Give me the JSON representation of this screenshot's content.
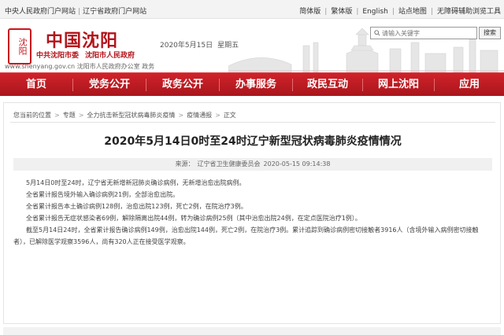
{
  "topbar": {
    "links_left": [
      "中央人民政府门户网站",
      "辽宁省政府门户网站"
    ],
    "links_right": [
      "简体版",
      "繁体版",
      "English",
      "站点地图",
      "无障碍辅助浏览工具"
    ]
  },
  "header": {
    "site_name": "中国沈阳",
    "org_party": "中共沈阳市委",
    "org_gov": "沈阳市人民政府",
    "domain_text": "www.shenyang.gov.cn 沈阳市人民政府办公室 政务",
    "emblem_text": "沈阳",
    "date": "2020年5月15日",
    "weekday": "星期五",
    "search_placeholder": "请输入关键字",
    "search_button": "搜索"
  },
  "nav": {
    "items": [
      "首页",
      "党务公开",
      "政务公开",
      "办事服务",
      "政民互动",
      "网上沈阳",
      "应用"
    ]
  },
  "breadcrumb": {
    "items": [
      "您当前的位置",
      "专题",
      "全力抗击新型冠状病毒肺炎疫情",
      "疫情通报",
      "正文"
    ]
  },
  "article": {
    "title": "2020年5月14日0时至24时辽宁新型冠状病毒肺炎疫情情况",
    "source_label": "来源：",
    "source": "辽宁省卫生健康委员会",
    "datetime": "2020-05-15 09:14:38",
    "paragraphs": [
      "5月14日0时至24时，辽宁省无新增新冠肺炎确诊病例，无新增治愈出院病例。",
      "全省累计报告境外输入确诊病例21例，全部治愈出院。",
      "全省累计报告本土确诊病例128例，治愈出院123例，死亡2例，在院治疗3例。",
      "全省累计报告无症状感染者69例，解除隔离出院44例，转为确诊病例25例（其中治愈出院24例，在定点医院治疗1例）。",
      "截至5月14日24时，全省累计报告确诊病例149例，治愈出院144例，死亡2例，在院治疗3例。累计追踪到确诊病例密切接触者3916人（含境外输入病例密切接触者），已解除医学观察3596人，尚有320人正在接受医学观察。"
    ]
  },
  "colors": {
    "brand_red": "#c8161d",
    "nav_red": "#b81c22"
  },
  "icons": {
    "search": "search-icon",
    "emblem": "city-emblem-icon"
  }
}
